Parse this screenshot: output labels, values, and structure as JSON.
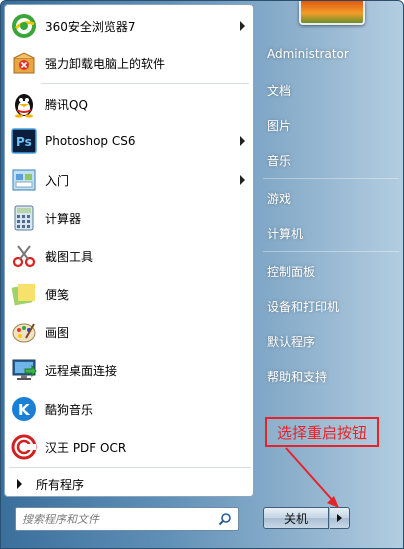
{
  "programs": [
    {
      "label": "360安全浏览器7",
      "icon": "browser-360-icon",
      "has_submenu": true
    },
    {
      "label": "强力卸载电脑上的软件",
      "icon": "uninstall-box-icon",
      "has_submenu": false
    },
    {
      "label": "腾讯QQ",
      "icon": "qq-penguin-icon",
      "has_submenu": false
    },
    {
      "label": "Photoshop CS6",
      "icon": "photoshop-icon",
      "has_submenu": true
    },
    {
      "label": "入门",
      "icon": "getting-started-icon",
      "has_submenu": true
    },
    {
      "label": "计算器",
      "icon": "calculator-icon",
      "has_submenu": false
    },
    {
      "label": "截图工具",
      "icon": "snipping-tool-icon",
      "has_submenu": false
    },
    {
      "label": "便笺",
      "icon": "sticky-notes-icon",
      "has_submenu": false
    },
    {
      "label": "画图",
      "icon": "paint-palette-icon",
      "has_submenu": false
    },
    {
      "label": "远程桌面连接",
      "icon": "remote-desktop-icon",
      "has_submenu": false
    },
    {
      "label": "酷狗音乐",
      "icon": "kugou-music-icon",
      "has_submenu": false
    },
    {
      "label": "汉王 PDF OCR",
      "icon": "hanwang-ocr-icon",
      "has_submenu": false
    }
  ],
  "all_programs_label": "所有程序",
  "search": {
    "placeholder": "搜索程序和文件"
  },
  "right_panel": {
    "user": "Administrator",
    "items_group1": [
      "文档",
      "图片",
      "音乐"
    ],
    "items_group2": [
      "游戏",
      "计算机"
    ],
    "items_group3": [
      "控制面板",
      "设备和打印机",
      "默认程序",
      "帮助和支持"
    ]
  },
  "shutdown_label": "关机",
  "annotation": {
    "text": "选择重启按钮",
    "color": "#e5242a"
  }
}
